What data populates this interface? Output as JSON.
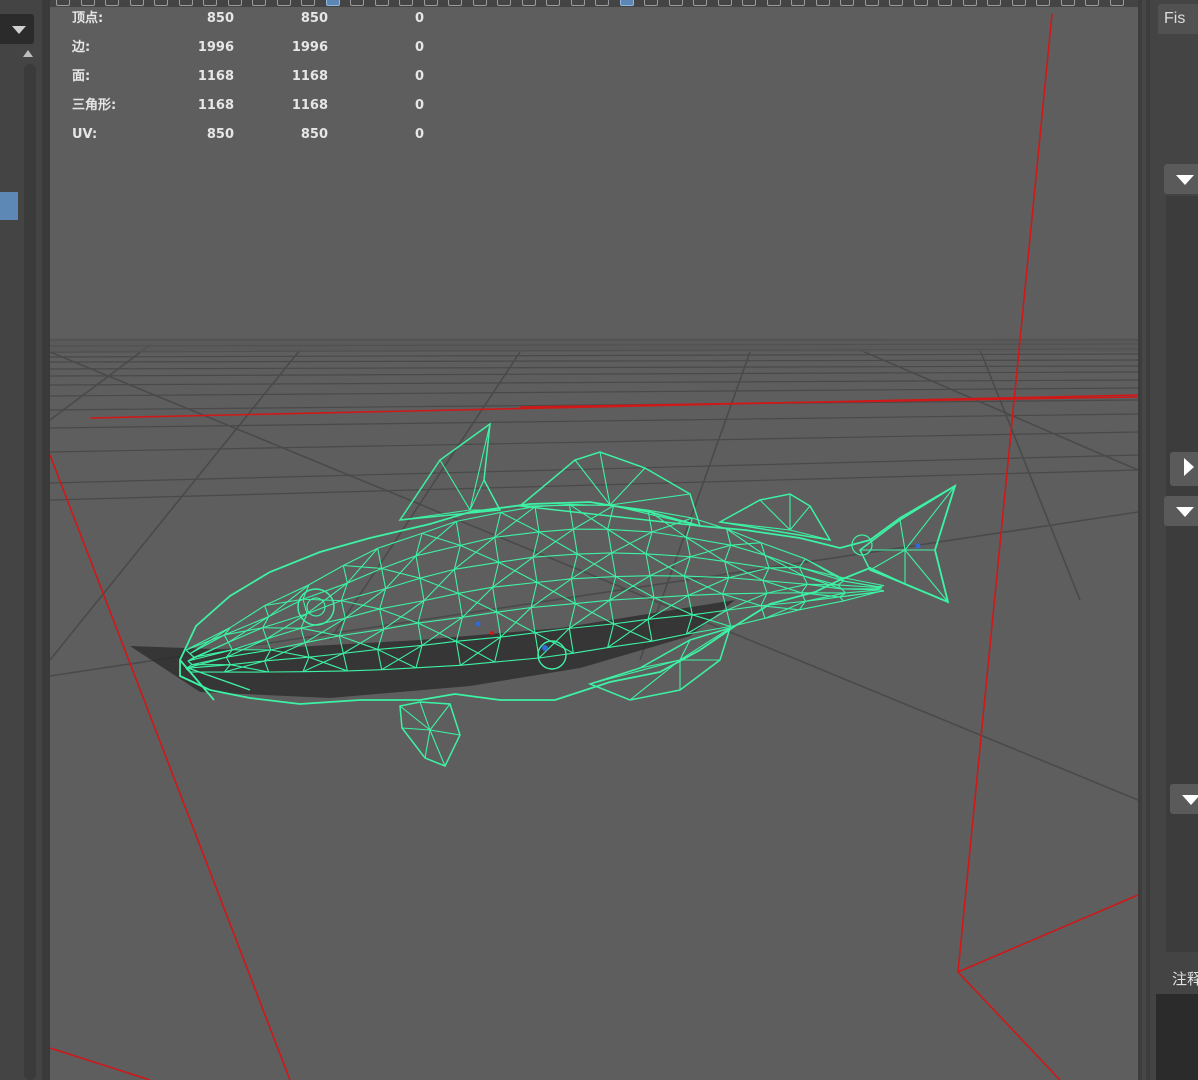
{
  "hud": {
    "rows": [
      {
        "label": "顶点:",
        "c1": "850",
        "c2": "850",
        "c3": "0"
      },
      {
        "label": "边:",
        "c1": "1996",
        "c2": "1996",
        "c3": "0"
      },
      {
        "label": "面:",
        "c1": "1168",
        "c2": "1168",
        "c3": "0"
      },
      {
        "label": "三角形:",
        "c1": "1168",
        "c2": "1168",
        "c3": "0"
      },
      {
        "label": "UV:",
        "c1": "850",
        "c2": "850",
        "c3": "0"
      }
    ]
  },
  "right_panel": {
    "tab_label": "Fis",
    "notes_label": "注释"
  },
  "viewport": {
    "model": "fish-wireframe",
    "colors": {
      "background": "#5e5e5e",
      "wireframe": "#3df2a4",
      "axis": "#d01818",
      "grid": "#494949",
      "selection_blue": "#5d88b5"
    }
  }
}
